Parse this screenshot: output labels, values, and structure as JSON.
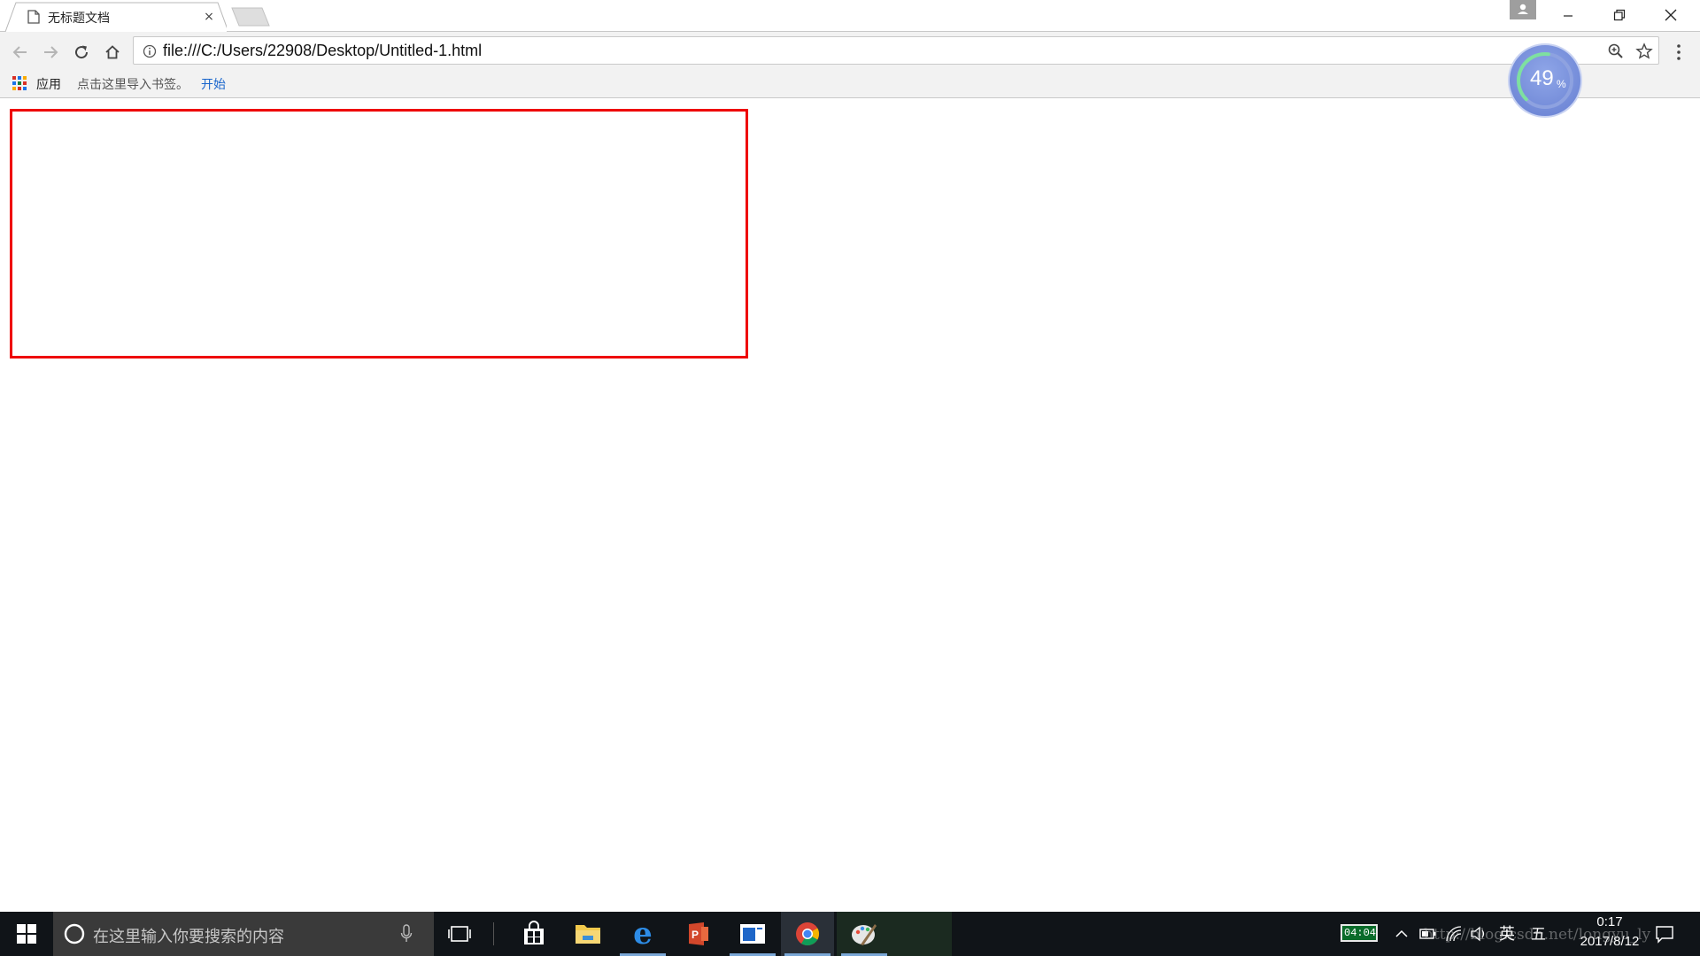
{
  "browser": {
    "tab_title": "无标题文档",
    "tab_close": "×",
    "url": "file:///C:/Users/22908/Desktop/Untitled-1.html",
    "bookmarks": {
      "apps_label": "应用",
      "import_text": "点击这里导入书签。",
      "start_link": "开始"
    }
  },
  "floating_meter": {
    "value": "49",
    "unit": "%",
    "level_percent": 49
  },
  "page": {
    "box_border_color": "#ee0000"
  },
  "taskbar": {
    "search_placeholder": "在这里输入你要搜索的内容",
    "pinned_apps": [
      "store-icon",
      "file-explorer-icon",
      "edge-icon",
      "powerpoint-icon",
      "app-window-icon",
      "chrome-icon",
      "paint-icon"
    ],
    "battery_badge": "04:04",
    "ime_language": "英",
    "ime_mode": "五",
    "clock_time": "0:17",
    "clock_date": "2017/8/12",
    "watermark": "http://blog.csdn.net/longyu_ly"
  }
}
